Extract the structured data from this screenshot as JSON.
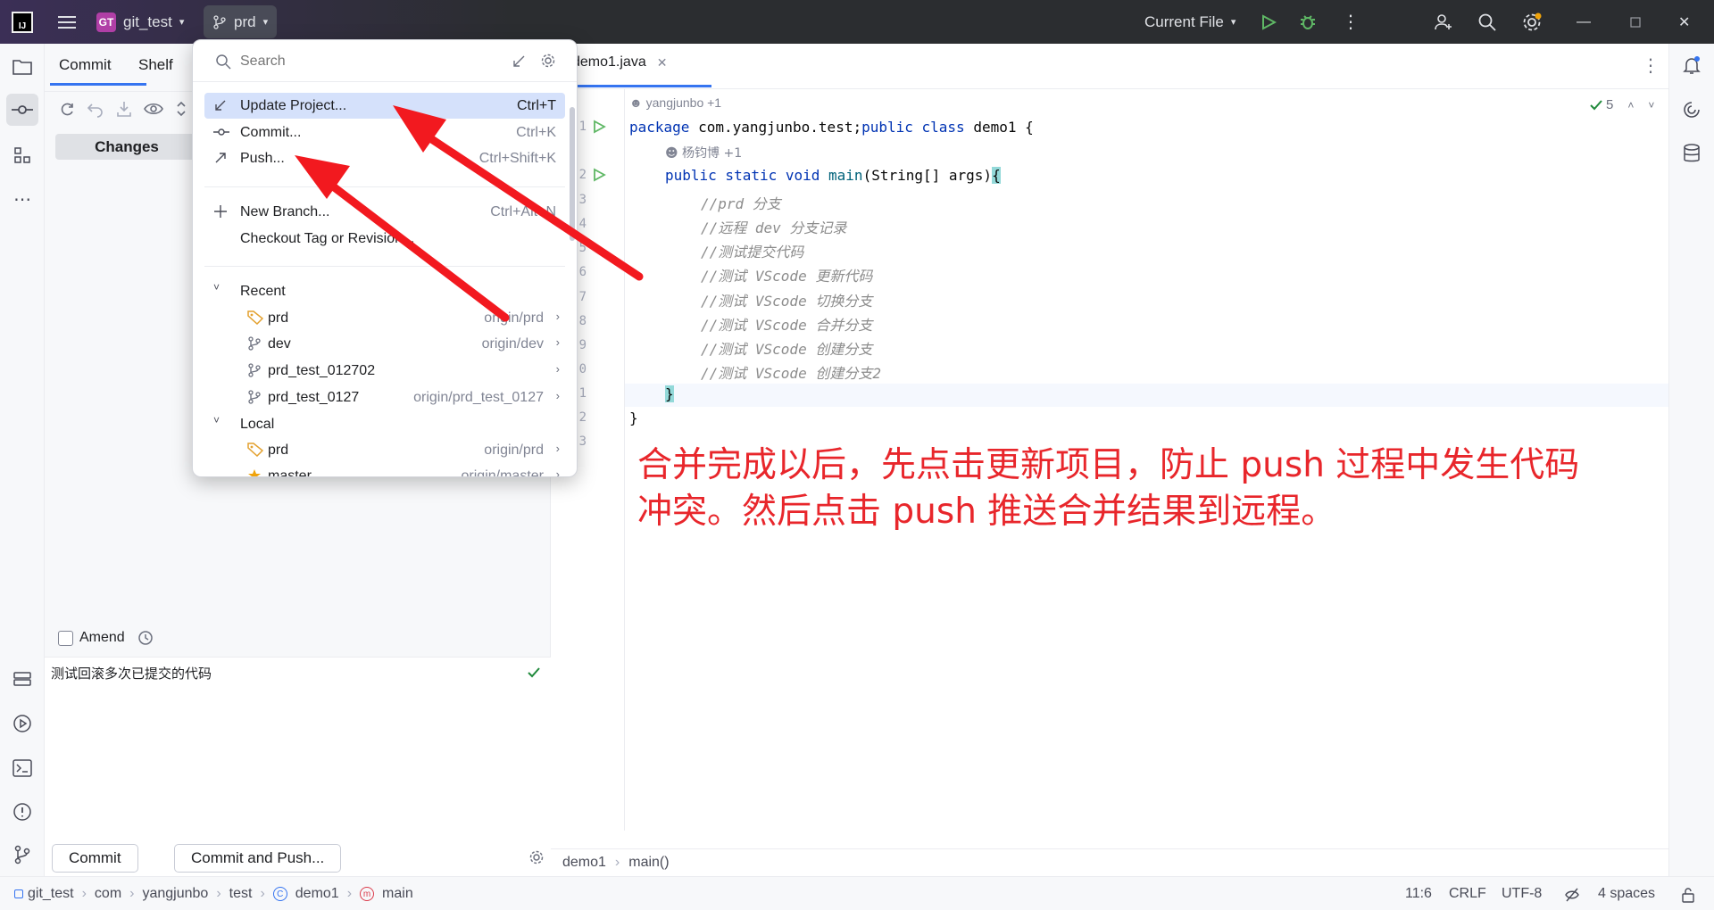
{
  "titlebar": {
    "project_badge": "GT",
    "project": "git_test",
    "branch": "prd",
    "run_config": "Current File"
  },
  "commit_panel": {
    "tab_commit": "Commit",
    "tab_shelf": "Shelf",
    "changes_label": "Changes",
    "amend_label": "Amend",
    "message": "测试回滚多次已提交的代码",
    "commit_button": "Commit",
    "commit_push_button": "Commit and Push..."
  },
  "editor": {
    "tab_name": "demo1.java",
    "inspections_count": "5",
    "author_line1": "yangjunbo +1",
    "author_line2": "杨钧博 +1",
    "line_numbers": [
      "1",
      "2",
      "3",
      "4",
      "5",
      "6",
      "7",
      "8",
      "9",
      "0",
      "1",
      "2",
      "3"
    ],
    "lines": [
      {
        "kw1": "package ",
        "text1": "com.yangjunbo.test;",
        "kw2": "public class ",
        "text2": "demo1 {"
      },
      {
        "kw": "public static void ",
        "fn": "main",
        "rest": "(String[] args)",
        "brace": "{"
      },
      {
        "comment": "//prd 分支"
      },
      {
        "comment": "//远程 dev 分支记录"
      },
      {
        "comment": "//测试提交代码"
      },
      {
        "comment": "//测试 VScode 更新代码"
      },
      {
        "comment": "//测试 VScode 切换分支"
      },
      {
        "comment": "//测试 VScode 合并分支"
      },
      {
        "comment": "//测试 VScode 创建分支"
      },
      {
        "comment": "//测试 VScode 创建分支2"
      },
      {
        "brace": "}"
      },
      {
        "brace": "}"
      }
    ],
    "breadcrumb_class": "demo1",
    "breadcrumb_method": "main()"
  },
  "popup": {
    "search_placeholder": "Search",
    "actions": [
      {
        "label": "Update Project...",
        "shortcut": "Ctrl+T"
      },
      {
        "label": "Commit...",
        "shortcut": "Ctrl+K"
      },
      {
        "label": "Push...",
        "shortcut": "Ctrl+Shift+K"
      },
      {
        "label": "New Branch...",
        "shortcut": "Ctrl+Alt+N"
      },
      {
        "label": "Checkout Tag or Revision...",
        "shortcut": ""
      }
    ],
    "recent_header": "Recent",
    "recent": [
      {
        "name": "prd",
        "remote": "origin/prd"
      },
      {
        "name": "dev",
        "remote": "origin/dev"
      },
      {
        "name": "prd_test_012702",
        "remote": ""
      },
      {
        "name": "prd_test_0127",
        "remote": "origin/prd_test_0127"
      }
    ],
    "local_header": "Local",
    "local": [
      {
        "name": "prd",
        "remote": "origin/prd"
      },
      {
        "name": "master",
        "remote": "origin/master"
      }
    ]
  },
  "statusbar": {
    "crumbs": [
      "git_test",
      "com",
      "yangjunbo",
      "test",
      "demo1",
      "main"
    ],
    "position": "11:6",
    "line_sep": "CRLF",
    "encoding": "UTF-8",
    "indent": "4 spaces"
  },
  "annotation": {
    "line1": "合并完成以后，先点击更新项目，防止 push 过程中发生代码",
    "line2": "冲突。然后点击 push 推送合并结果到远程。"
  },
  "colors": {
    "accent": "#3574f0",
    "selection": "#d5e1fb",
    "annotation": "#e8262b",
    "run_green": "#4caf50"
  }
}
